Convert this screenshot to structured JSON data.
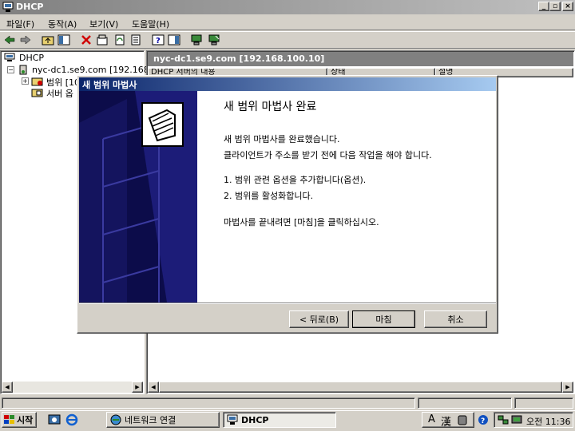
{
  "app": {
    "title": "DHCP"
  },
  "menu": {
    "items": [
      "파일(F)",
      "동작(A)",
      "보기(V)",
      "도움말(H)"
    ]
  },
  "tree": {
    "root": "DHCP",
    "server": "nyc-dc1.se9.com [192.168.",
    "scope": "범위 [10",
    "options": "서버 옵"
  },
  "right_pane": {
    "title": "nyc-dc1.se9.com [192.168.100.10]",
    "columns": [
      "DHCP 서버의 내용",
      "상태",
      "설명"
    ]
  },
  "wizard": {
    "title": "새 범위 마법사",
    "heading": "새 범위 마법사 완료",
    "line1": "새 범위 마법사를 완료했습니다.",
    "line2": "클라이언트가 주소를 받기 전에 다음 작업을 해야 합니다.",
    "step1": "1. 범위 관련 옵션을 추가합니다(옵션).",
    "step2": "2. 범위를 활성화합니다.",
    "line3": "마법사를 끝내려면 [마침]을 클릭하십시오.",
    "back_label": "< 뒤로(B)",
    "finish_label": "마침",
    "cancel_label": "취소"
  },
  "taskbar": {
    "start_label": "시작",
    "tasks": [
      "네트워크 연결",
      "DHCP"
    ],
    "ime_letter": "A",
    "ime_hanja": "漢",
    "clock": "오전 11:36"
  },
  "colors": {
    "title_active": "#0a246a",
    "title_inactive": "#808080",
    "wizard_side": "#0c0c4a"
  }
}
